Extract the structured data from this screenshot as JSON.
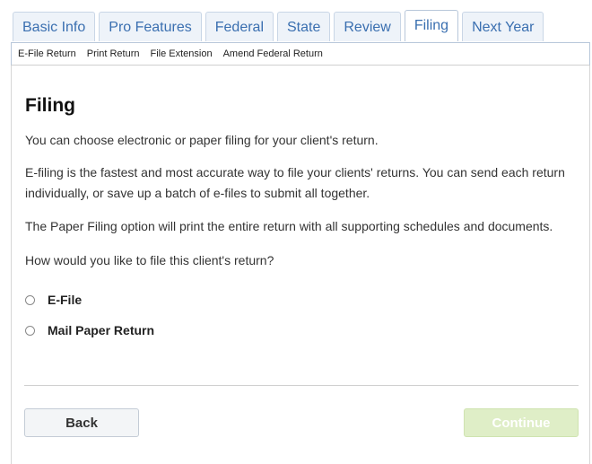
{
  "tabs": [
    {
      "label": "Basic Info"
    },
    {
      "label": "Pro Features"
    },
    {
      "label": "Federal"
    },
    {
      "label": "State"
    },
    {
      "label": "Review"
    },
    {
      "label": "Filing"
    },
    {
      "label": "Next Year"
    }
  ],
  "active_tab": "Filing",
  "subnav": [
    {
      "label": "E-File Return"
    },
    {
      "label": "Print Return"
    },
    {
      "label": "File Extension"
    },
    {
      "label": "Amend Federal Return"
    }
  ],
  "main": {
    "title": "Filing",
    "paragraphs": [
      "You can choose electronic or paper filing for your client's return.",
      "E-filing is the fastest and most accurate way to file your clients' returns. You can send each return individually, or save up a batch of e-files to submit all together.",
      "The Paper Filing option will print the entire return with all supporting schedules and documents.",
      "How would you like to file this client's return?"
    ],
    "options": [
      {
        "label": "E-File",
        "selected": false
      },
      {
        "label": "Mail Paper Return",
        "selected": false
      }
    ]
  },
  "buttons": {
    "back_label": "Back",
    "continue_label": "Continue",
    "continue_disabled": true
  },
  "colors": {
    "tab_text": "#3a6fb0",
    "continue_bg": "#dfeec7"
  }
}
